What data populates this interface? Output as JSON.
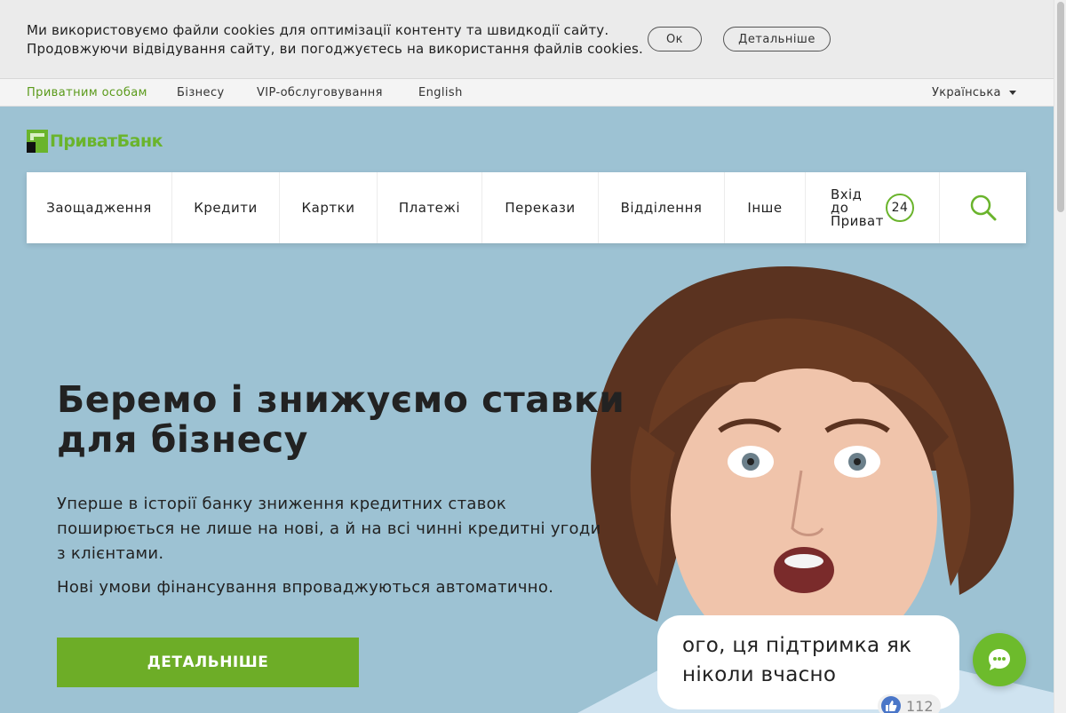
{
  "cookie_bar": {
    "line1": "Ми використовуємо файли cookies для оптимізації контенту та швидкодії сайту.",
    "line2": "Продовжуючи відвідування сайту, ви погоджуєтесь на використання файлів cookies.",
    "ok_label": "Ок",
    "more_label": "Детальніше"
  },
  "top_nav": {
    "items": [
      {
        "label": "Приватним особам",
        "active": true
      },
      {
        "label": "Бізнесу",
        "active": false
      },
      {
        "label": "VIP-обслуговування",
        "active": false
      },
      {
        "label": "English",
        "active": false
      }
    ],
    "language": "Українська"
  },
  "logo": {
    "text": "ПриватБанк",
    "brand_color": "#6ab42c"
  },
  "main_nav": {
    "items": [
      "Заощадження",
      "Кредити",
      "Картки",
      "Платежі",
      "Перекази",
      "Відділення",
      "Інше"
    ],
    "login_line1": "Вхід до",
    "login_line2": "Приват",
    "login_badge": "24",
    "search_icon": "search-icon"
  },
  "hero": {
    "title_line1": "Беремо і знижуємо ставки",
    "title_line2": "для бізнесу",
    "paragraph1": "Уперше в історії банку зниження кредитних ставок поширюється не лише на нові, а й на всі чинні кредитні угоди з клієнтами.",
    "paragraph2": "Нові умови фінансування впроваджуються автоматично.",
    "cta_label": "ДЕТАЛЬНІШЕ",
    "cta_color": "#6dad27"
  },
  "chat": {
    "bubble_line1": "ого, ця підтримка як",
    "bubble_line2": "ніколи вчасно",
    "likes": "112",
    "fab_icon": "chat-icon"
  }
}
